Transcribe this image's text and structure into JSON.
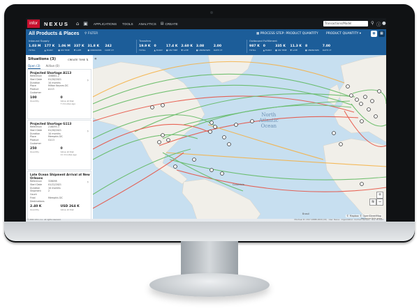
{
  "topbar": {
    "logo": "infor",
    "brand": "NEXUS",
    "nav": [
      "APPLICATIONS",
      "TOOLS",
      "ANALYTICS",
      "CREATE"
    ],
    "search_placeholder": "Transactions/Model",
    "icons": [
      "home-icon",
      "clipboard-icon",
      "document-icon",
      "info-icon",
      "user-icon"
    ]
  },
  "header": {
    "title": "All Products & Places",
    "filter": "FILTER",
    "process_step": "PROCESS STEP: PRODUCT QUANTITY",
    "product_quantity": "PRODUCT QUANTITY",
    "sections": [
      {
        "title": "Inbound Supply",
        "metrics": [
          {
            "value": "1.03 M",
            "label": "TOTAL"
          },
          {
            "value": "177 K",
            "label": "▲ EARLY"
          },
          {
            "value": "1.06 M",
            "label": "● ON TIME"
          },
          {
            "value": "337 K",
            "label": "▼ LATE"
          },
          {
            "value": "31.8 K",
            "label": "● UNKNOWN"
          },
          {
            "value": "242",
            "label": "DATE CT"
          }
        ]
      },
      {
        "title": "Transfers",
        "metrics": [
          {
            "value": "19.9 K",
            "label": "TOTAL"
          },
          {
            "value": "0",
            "label": "▲ EARLY"
          },
          {
            "value": "17.4 K",
            "label": "● ON TIME"
          },
          {
            "value": "2.60 K",
            "label": "▼ LATE"
          },
          {
            "value": "3.08",
            "label": "● UNKNOWN"
          },
          {
            "value": "2.00",
            "label": "DATE CT"
          }
        ]
      },
      {
        "title": "Outbound Fulfillment",
        "metrics": [
          {
            "value": "987 K",
            "label": "TOTAL"
          },
          {
            "value": "0",
            "label": "▲ EARLY"
          },
          {
            "value": "335 K",
            "label": "● ON TIME"
          },
          {
            "value": "11.3 K",
            "label": "▼ LATE"
          },
          {
            "value": "8",
            "label": "● UNKNOWN"
          },
          {
            "value": "7.00",
            "label": "DATE CT"
          }
        ]
      }
    ]
  },
  "panel": {
    "title": "Situations (3)",
    "create": "CREATE TIME",
    "tabs": [
      "Open (3)",
      "Active (0)"
    ],
    "cards": [
      {
        "title": "Projected Shortage A113",
        "rows": [
          {
            "k": "Reference",
            "v": "456861-2"
          },
          {
            "k": "Start Date",
            "v": "01/18/2021"
          },
          {
            "k": "Duration",
            "v": "10 months"
          },
          {
            "k": "Place",
            "v": "Milton Keynes DC"
          },
          {
            "k": "Product",
            "v": "A113"
          },
          {
            "k": "Customer",
            "v": ""
          }
        ],
        "n1": "100",
        "n1l": "Quantity",
        "n2": "0",
        "n2l": "Value at Risk",
        "ago": "7 minutes ago"
      },
      {
        "title": "Projected Shortage G113",
        "rows": [
          {
            "k": "Reference",
            "v": "216095-3"
          },
          {
            "k": "Start Date",
            "v": "01/18/2021"
          },
          {
            "k": "Duration",
            "v": "10 months"
          },
          {
            "k": "Place",
            "v": "Memphis DC"
          },
          {
            "k": "Product",
            "v": "G113"
          },
          {
            "k": "Customer",
            "v": ""
          }
        ],
        "n1": "250",
        "n1l": "Quantity",
        "n2": "0",
        "n2l": "Value at Risk",
        "ago": "11 minutes ago"
      },
      {
        "title": "Late Ocean Shipment Arrival at New Orleans",
        "rows": [
          {
            "k": "Reference",
            "v": "328098"
          },
          {
            "k": "Start Date",
            "v": "01/12/2021"
          },
          {
            "k": "Duration",
            "v": "10 months"
          },
          {
            "k": "Shipment Count",
            "v": "2"
          },
          {
            "k": "Final Destinations",
            "v": "Memphis DC"
          }
        ],
        "n1": "2.40 K",
        "n1l": "Quantity",
        "n2": "USD 264 K",
        "n2l": "Value at Risk",
        "ago": ""
      }
    ]
  },
  "map": {
    "ocean_label": "North Atlantic Ocean",
    "ocean_lines": [
      "North",
      "Atlantic",
      "Ocean"
    ],
    "places": [
      "Colombia",
      "Brasil"
    ],
    "attribution": "© Mapbox © OpenStreetMap",
    "improve": "Improve this map"
  },
  "footer": {
    "copyright": "© 2021 Infor, Inc. All rights reserved.",
    "right": "Montreal ID: 2017-04888-0000 (CD) · User: Nexus · Organization: Contract Karlsson · Nov 18 2021"
  },
  "colors": {
    "header_bg": "#1c5d99",
    "topbar_bg": "#15181b",
    "route_on_time": "#5cb85c",
    "route_late": "#e74c3c",
    "route_early": "#f5b041"
  }
}
